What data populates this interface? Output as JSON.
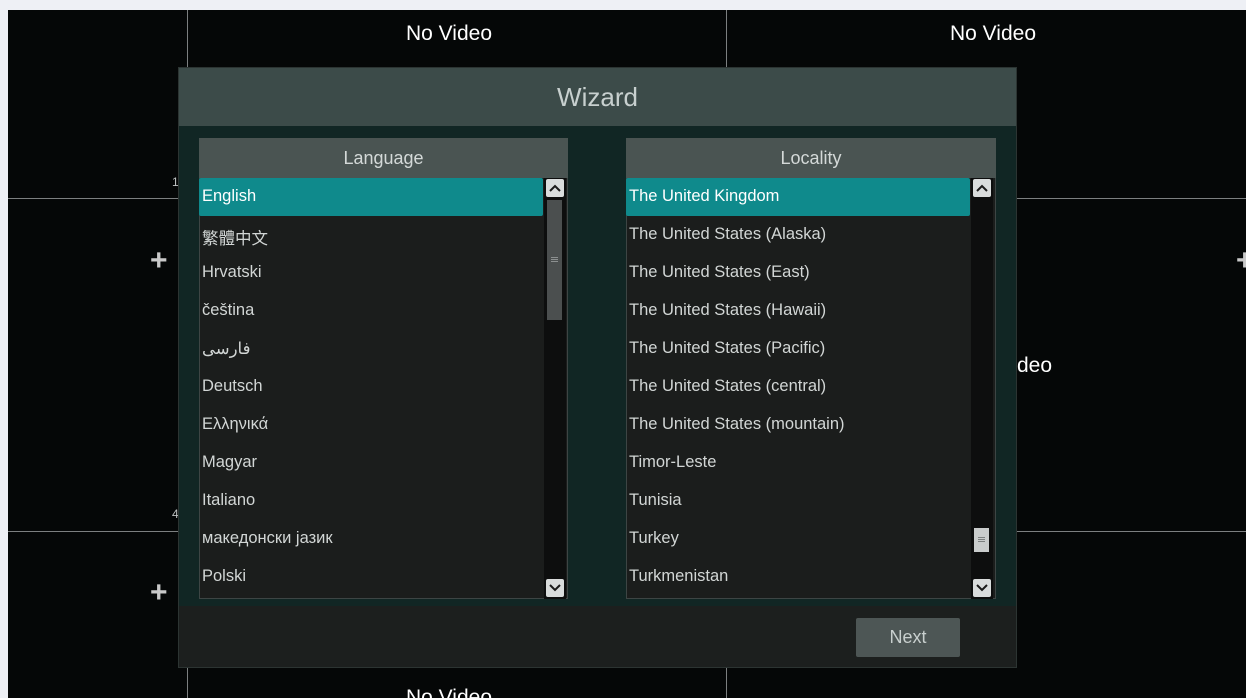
{
  "background": {
    "cells": {
      "top_mid": "No Video",
      "top_right": "No Video",
      "mid_right_partial": "deo",
      "bottom_mid_partial": "No Video"
    },
    "channel_numbers": [
      "1",
      "4"
    ]
  },
  "wizard": {
    "title": "Wizard",
    "language": {
      "header": "Language",
      "items": [
        "English",
        "繁體中文",
        "Hrvatski",
        "čeština",
        "فارسی",
        "Deutsch",
        "Ελληνικά",
        "Magyar",
        "Italiano",
        "македонски јазик",
        "Polski"
      ],
      "selected": "English",
      "scroll_position": 0.0
    },
    "locality": {
      "header": "Locality",
      "items": [
        "The United Kingdom",
        "The United States (Alaska)",
        "The United States (East)",
        "The United States (Hawaii)",
        "The United States (Pacific)",
        "The United States (central)",
        "The United States (mountain)",
        "Timor-Leste",
        "Tunisia",
        "Turkey",
        "Turkmenistan"
      ],
      "selected": "The United Kingdom",
      "scroll_position": 0.96
    },
    "next_label": "Next"
  },
  "colors": {
    "selection": "#0f8a8c",
    "header": "#3c4b49",
    "body": "#112624"
  },
  "icons": [
    "plus-icon",
    "chevron-up-icon",
    "chevron-down-icon"
  ]
}
